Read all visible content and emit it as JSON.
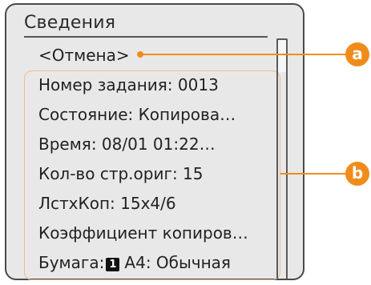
{
  "panel": {
    "title": "Сведения",
    "cancel_label": "<Отмена>",
    "rows": [
      "Номер задания: 0013",
      "Состояние: Копирова…",
      "Время: 08/01 01:22…",
      "Кол-во стр.ориг: 15",
      "ЛстхКоп: 15x4/6",
      "Коэффициент копиров…"
    ],
    "paper": {
      "label": "Бумага:",
      "drawer_number": "1",
      "value": "A4: Обычная"
    }
  },
  "callouts": {
    "a": "a",
    "b": "b"
  },
  "colors": {
    "accent": "#f08c1c",
    "panel_bg": "#e8e8e8",
    "list_border": "#f3b98d"
  }
}
